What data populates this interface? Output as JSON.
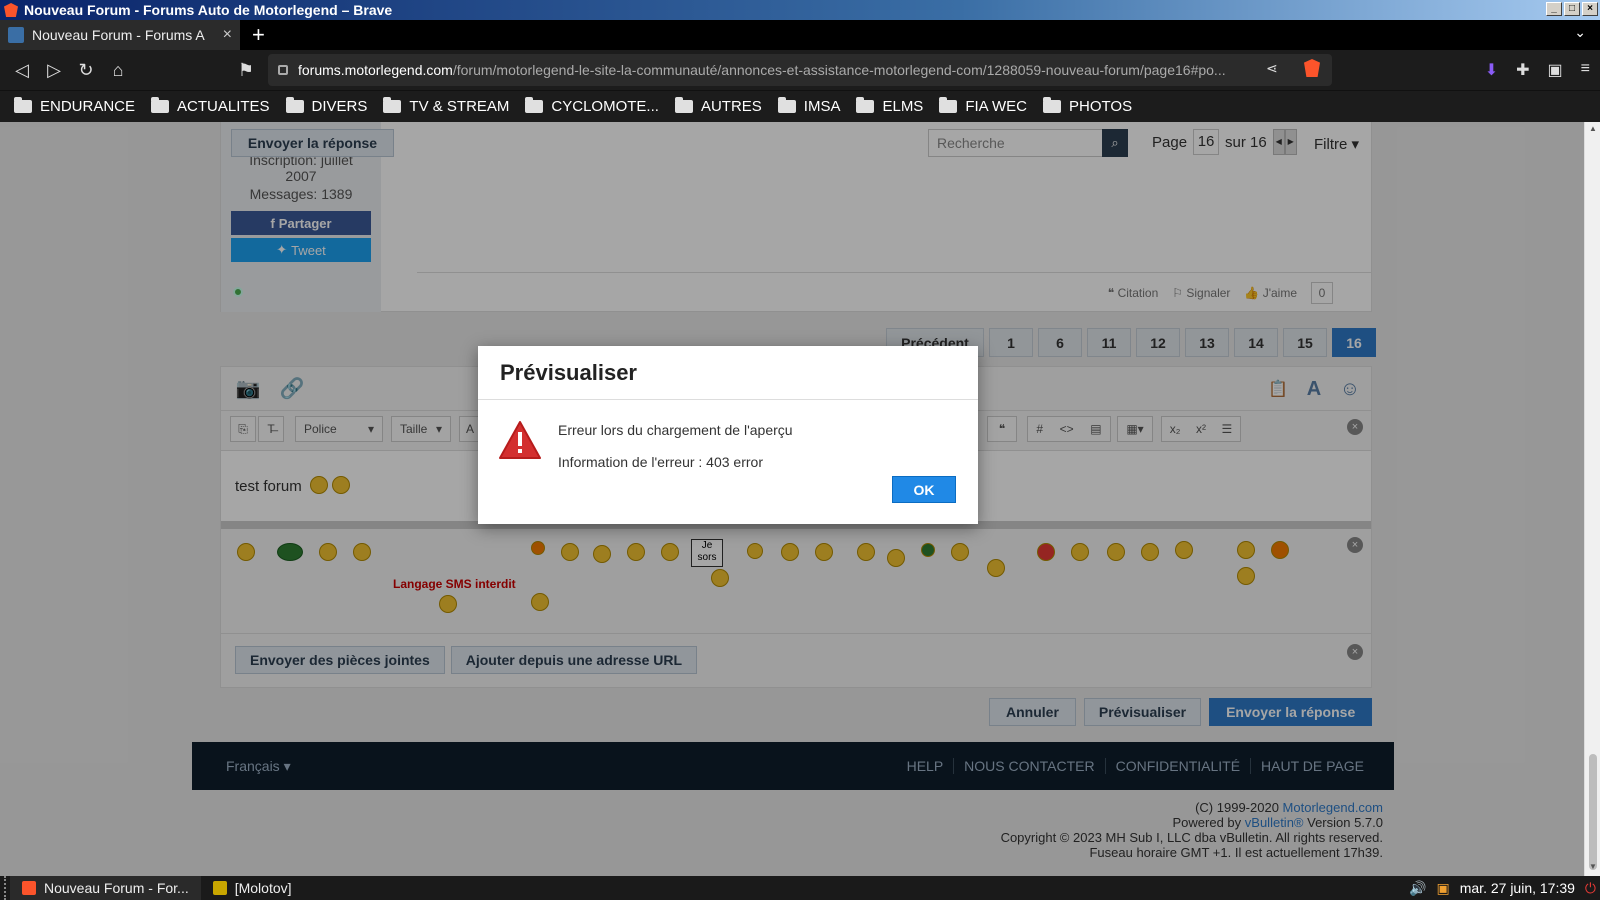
{
  "window": {
    "title": "Nouveau Forum - Forums Auto de Motorlegend – Brave"
  },
  "tab": {
    "title": "Nouveau Forum - Forums A",
    "close": "×",
    "new": "+"
  },
  "address": {
    "host": "forums.motorlegend.com",
    "path": "/forum/motorlegend-le-site-la-communauté/annonces-et-assistance-motorlegend-com/1288059-nouveau-forum/page16#po..."
  },
  "bookmarks": [
    "ENDURANCE",
    "ACTUALITES",
    "DIVERS",
    "TV & STREAM",
    "CYCLOMOTE...",
    "AUTRES",
    "IMSA",
    "ELMS",
    "FIA WEC",
    "PHOTOS"
  ],
  "topbar": {
    "reply_label": "Envoyer la réponse",
    "search_placeholder": "Recherche",
    "page_label": "Page",
    "page_current": "16",
    "page_of": "sur 16",
    "filter_label": "Filtre ▾"
  },
  "user": {
    "joined": "Inscription: juillet",
    "year": "2007",
    "messages": "Messages: 1389",
    "share": "Partager",
    "tweet": "Tweet"
  },
  "post_actions": {
    "quote": "Citation",
    "report": "Signaler",
    "like": "J'aime",
    "like_count": "0"
  },
  "pagination": [
    "Précédent",
    "1",
    "6",
    "11",
    "12",
    "13",
    "14",
    "15",
    "16"
  ],
  "editor": {
    "font_label": "Police",
    "size_label": "Taille",
    "text": "test forum",
    "sms_label": "Langage SMS interdit",
    "attach_label": "Envoyer des pièces jointes",
    "url_label": "Ajouter depuis une adresse URL",
    "sign_text": "Je sors"
  },
  "buttons": {
    "cancel": "Annuler",
    "preview": "Prévisualiser",
    "send": "Envoyer la réponse"
  },
  "footer": {
    "language": "Français ▾",
    "links": [
      "HELP",
      "NOUS CONTACTER",
      "CONFIDENTIALITÉ",
      "HAUT DE PAGE"
    ]
  },
  "copyright": {
    "line1_prefix": "(C) 1999-2020 ",
    "line1_link": "Motorlegend.com",
    "line2_prefix": "Powered by ",
    "line2_link": "vBulletin®",
    "line2_suffix": " Version 5.7.0",
    "line3": "Copyright © 2023 MH Sub I, LLC dba vBulletin. All rights reserved.",
    "line4": "Fuseau horaire GMT +1. Il est actuellement 17h39."
  },
  "dialog": {
    "title": "Prévisualiser",
    "message": "Erreur lors du chargement de l'aperçu",
    "error": "Information de l'erreur : 403 error",
    "ok": "OK"
  },
  "taskbar": {
    "task1": "Nouveau Forum - For...",
    "task2": "[Molotov]",
    "clock": "mar. 27 juin, 17:39"
  },
  "colors": {
    "accent": "#2f7ac8",
    "ok_button": "#2089e6",
    "warning": "#d32f2f",
    "facebook": "#3b5998",
    "twitter": "#1da1f2"
  }
}
